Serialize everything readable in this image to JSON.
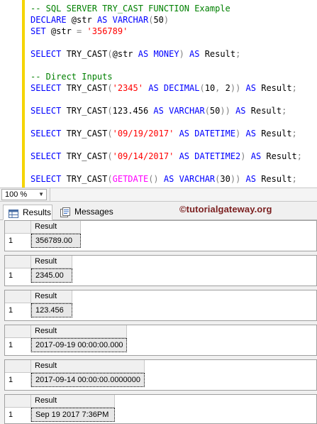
{
  "editor": {
    "lines": [
      [
        {
          "t": "-- SQL SERVER TRY_CAST FUNCTION Example",
          "c": "cm"
        }
      ],
      [
        {
          "t": "DECLARE",
          "c": "kw"
        },
        {
          "t": " @str ",
          "c": ""
        },
        {
          "t": "AS",
          "c": "kw"
        },
        {
          "t": " ",
          "c": ""
        },
        {
          "t": "VARCHAR",
          "c": "kw"
        },
        {
          "t": "(",
          "c": "op"
        },
        {
          "t": "50",
          "c": ""
        },
        {
          "t": ")",
          "c": "op"
        }
      ],
      [
        {
          "t": "SET",
          "c": "kw"
        },
        {
          "t": " @str ",
          "c": ""
        },
        {
          "t": "=",
          "c": "op"
        },
        {
          "t": " ",
          "c": ""
        },
        {
          "t": "'356789'",
          "c": "str"
        }
      ],
      [],
      [
        {
          "t": "SELECT",
          "c": "kw"
        },
        {
          "t": " TRY_CAST",
          "c": ""
        },
        {
          "t": "(",
          "c": "op"
        },
        {
          "t": "@str ",
          "c": ""
        },
        {
          "t": "AS",
          "c": "kw"
        },
        {
          "t": " ",
          "c": ""
        },
        {
          "t": "MONEY",
          "c": "kw"
        },
        {
          "t": ")",
          "c": "op"
        },
        {
          "t": " ",
          "c": ""
        },
        {
          "t": "AS",
          "c": "kw"
        },
        {
          "t": " Result",
          "c": ""
        },
        {
          "t": ";",
          "c": "op"
        }
      ],
      [],
      [
        {
          "t": "-- Direct Inputs",
          "c": "cm"
        }
      ],
      [
        {
          "t": "SELECT",
          "c": "kw"
        },
        {
          "t": " TRY_CAST",
          "c": ""
        },
        {
          "t": "(",
          "c": "op"
        },
        {
          "t": "'2345'",
          "c": "str"
        },
        {
          "t": " ",
          "c": ""
        },
        {
          "t": "AS",
          "c": "kw"
        },
        {
          "t": " ",
          "c": ""
        },
        {
          "t": "DECIMAL",
          "c": "kw"
        },
        {
          "t": "(",
          "c": "op"
        },
        {
          "t": "10",
          "c": ""
        },
        {
          "t": ",",
          "c": "op"
        },
        {
          "t": " 2",
          "c": ""
        },
        {
          "t": "))",
          "c": "op"
        },
        {
          "t": " ",
          "c": ""
        },
        {
          "t": "AS",
          "c": "kw"
        },
        {
          "t": " Result",
          "c": ""
        },
        {
          "t": ";",
          "c": "op"
        }
      ],
      [],
      [
        {
          "t": "SELECT",
          "c": "kw"
        },
        {
          "t": " TRY_CAST",
          "c": ""
        },
        {
          "t": "(",
          "c": "op"
        },
        {
          "t": "123.456 ",
          "c": ""
        },
        {
          "t": "AS",
          "c": "kw"
        },
        {
          "t": " ",
          "c": ""
        },
        {
          "t": "VARCHAR",
          "c": "kw"
        },
        {
          "t": "(",
          "c": "op"
        },
        {
          "t": "50",
          "c": ""
        },
        {
          "t": "))",
          "c": "op"
        },
        {
          "t": " ",
          "c": ""
        },
        {
          "t": "AS",
          "c": "kw"
        },
        {
          "t": " Result",
          "c": ""
        },
        {
          "t": ";",
          "c": "op"
        }
      ],
      [],
      [
        {
          "t": "SELECT",
          "c": "kw"
        },
        {
          "t": " TRY_CAST",
          "c": ""
        },
        {
          "t": "(",
          "c": "op"
        },
        {
          "t": "'09/19/2017'",
          "c": "str"
        },
        {
          "t": " ",
          "c": ""
        },
        {
          "t": "AS",
          "c": "kw"
        },
        {
          "t": " ",
          "c": ""
        },
        {
          "t": "DATETIME",
          "c": "kw"
        },
        {
          "t": ")",
          "c": "op"
        },
        {
          "t": " ",
          "c": ""
        },
        {
          "t": "AS",
          "c": "kw"
        },
        {
          "t": " Result",
          "c": ""
        },
        {
          "t": ";",
          "c": "op"
        }
      ],
      [],
      [
        {
          "t": "SELECT",
          "c": "kw"
        },
        {
          "t": " TRY_CAST",
          "c": ""
        },
        {
          "t": "(",
          "c": "op"
        },
        {
          "t": "'09/14/2017'",
          "c": "str"
        },
        {
          "t": " ",
          "c": ""
        },
        {
          "t": "AS",
          "c": "kw"
        },
        {
          "t": " ",
          "c": ""
        },
        {
          "t": "DATETIME2",
          "c": "kw"
        },
        {
          "t": ")",
          "c": "op"
        },
        {
          "t": " ",
          "c": ""
        },
        {
          "t": "AS",
          "c": "kw"
        },
        {
          "t": " Result",
          "c": ""
        },
        {
          "t": ";",
          "c": "op"
        }
      ],
      [],
      [
        {
          "t": "SELECT",
          "c": "kw"
        },
        {
          "t": " TRY_CAST",
          "c": ""
        },
        {
          "t": "(",
          "c": "op"
        },
        {
          "t": "GETDATE",
          "c": "fn"
        },
        {
          "t": "()",
          "c": "op"
        },
        {
          "t": " ",
          "c": ""
        },
        {
          "t": "AS",
          "c": "kw"
        },
        {
          "t": " ",
          "c": ""
        },
        {
          "t": "VARCHAR",
          "c": "kw"
        },
        {
          "t": "(",
          "c": "op"
        },
        {
          "t": "30",
          "c": ""
        },
        {
          "t": "))",
          "c": "op"
        },
        {
          "t": " ",
          "c": ""
        },
        {
          "t": "AS",
          "c": "kw"
        },
        {
          "t": " Result",
          "c": ""
        },
        {
          "t": ";",
          "c": "op"
        }
      ]
    ]
  },
  "zoom": {
    "value": "100 %"
  },
  "tabs": {
    "results": "Results",
    "messages": "Messages"
  },
  "watermark": "©tutorialgateway.org",
  "results": [
    {
      "column": "Result",
      "row_number": "1",
      "value": "356789.00"
    },
    {
      "column": "Result",
      "row_number": "1",
      "value": "2345.00"
    },
    {
      "column": "Result",
      "row_number": "1",
      "value": "123.456"
    },
    {
      "column": "Result",
      "row_number": "1",
      "value": "2017-09-19 00:00:00.000"
    },
    {
      "column": "Result",
      "row_number": "1",
      "value": "2017-09-14 00:00:00.0000000"
    },
    {
      "column": "Result",
      "row_number": "1",
      "value": "Sep 19 2017  7:36PM"
    }
  ],
  "colors": {
    "keyword": "#0000ff",
    "comment": "#008000",
    "string": "#ff0000",
    "function": "#ff00ff",
    "change_bar": "#f5d400",
    "watermark": "#7b1f1f"
  },
  "icons": {
    "results_tab": "grid-icon",
    "messages_tab": "messages-icon",
    "zoom": "chevron-down-icon"
  }
}
